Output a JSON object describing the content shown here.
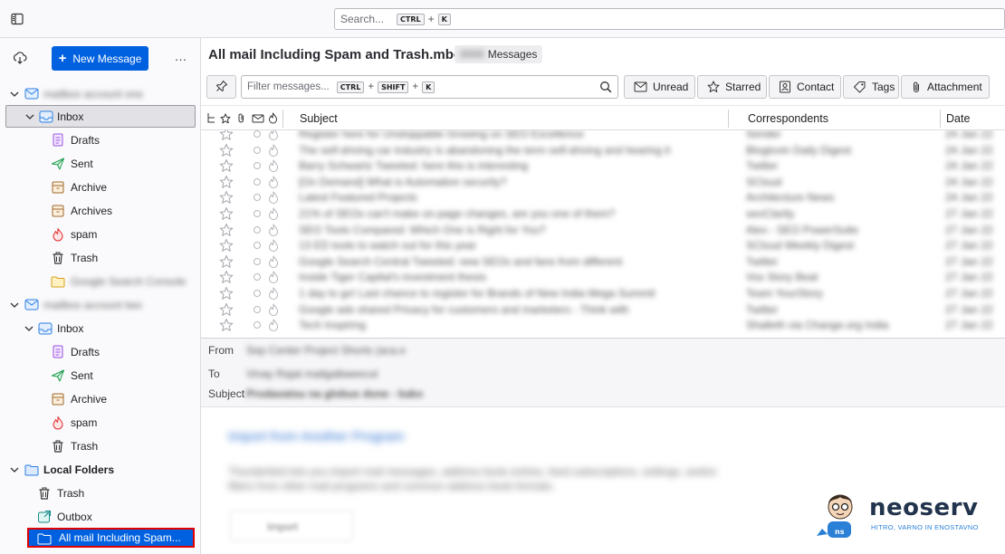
{
  "search": {
    "placeholder": "Search...",
    "kbd1": "CTRL",
    "plus": "+",
    "kbd2": "K"
  },
  "folderpane": {
    "new_message_label": "New Message",
    "menu_label": "…",
    "account1": {
      "name": "mailbox account one",
      "items": [
        "Inbox",
        "Drafts",
        "Sent",
        "Archive",
        "Archives",
        "spam",
        "Trash",
        "Google Search Console"
      ]
    },
    "account2": {
      "name": "mailbox account two",
      "items": [
        "Inbox",
        "Drafts",
        "Sent",
        "Archive",
        "spam",
        "Trash"
      ]
    },
    "local": {
      "name": "Local Folders",
      "items": [
        "Trash",
        "Outbox",
        "All mail Including Spam..."
      ]
    }
  },
  "threadpane": {
    "title": "All mail Including Spam and Trash.mbox",
    "count_number": "0000",
    "count_label": "Messages",
    "filter_placeholder": "Filter messages...",
    "filter_kbd": [
      "CTRL",
      "SHIFT",
      "K"
    ],
    "quick_filters": [
      "Unread",
      "Starred",
      "Contact",
      "Tags",
      "Attachment"
    ],
    "columns": {
      "subject": "Subject",
      "correspondents": "Correspondents",
      "date": "Date"
    },
    "rows": [
      {
        "subject": "Register here for Unstoppable Growing on SEO Excellence",
        "corr": "Sender",
        "date": "24 Jan 22"
      },
      {
        "subject": "The self-driving car industry is abandoning the term self-driving and hearing it",
        "corr": "Bloglovin Daily Digest",
        "date": "24 Jan 22"
      },
      {
        "subject": "Barry Schwartz Tweeted: here this is interesting",
        "corr": "Twitter",
        "date": "24 Jan 22"
      },
      {
        "subject": "[On Demand] What is Automation security?",
        "corr": "SCloud",
        "date": "24 Jan 22"
      },
      {
        "subject": "Latest Featured Projects",
        "corr": "Architecture News",
        "date": "24 Jan 22"
      },
      {
        "subject": "21% of SEOs can't make on-page changes, are you one of them?",
        "corr": "seoClarity",
        "date": "27 Jan 22"
      },
      {
        "subject": "SEO Tools Compared: Which One is Right for You?",
        "corr": "Alex - SEO PowerSuite",
        "date": "27 Jan 22"
      },
      {
        "subject": "13 ED tools to watch out for this year",
        "corr": "SCloud Weekly Digest",
        "date": "27 Jan 22"
      },
      {
        "subject": "Google Search Central Tweeted: new SEOs and fans from different",
        "corr": "Twitter",
        "date": "27 Jan 22"
      },
      {
        "subject": "Inside Tiger Capital's investment thesis",
        "corr": "Vox Story Beat",
        "date": "27 Jan 22"
      },
      {
        "subject": "1 day to go! Last chance to register for Brands of New India Mega Summit",
        "corr": "Team YourStory",
        "date": "27 Jan 22"
      },
      {
        "subject": "Google ads shared Privacy for customers and marketers - Think with",
        "corr": "Twitter",
        "date": "27 Jan 22"
      },
      {
        "subject": "Tech Inspiring",
        "corr": "Shalleth via Change.org India",
        "date": "27 Jan 22"
      }
    ]
  },
  "message": {
    "from_label": "From",
    "to_label": "To",
    "subject_label": "Subject",
    "from_value": "Sep Center Project Shorts (aca.e",
    "to_value": "Vinay Rajat mailgalbaeecut",
    "subject_value": "Prodavatsu na globus done - kako",
    "body_title": "Import from Another Program",
    "body_line1": "Thunderbird lets you import mail messages, address book entries, feed subscriptions, settings, and/or",
    "body_line2": "filters from other mail programs and common address book formats.",
    "body_button": "Import"
  },
  "logo": {
    "brand": "neoserv",
    "tagline": "HITRO, VARNO IN ENOSTAVNO"
  },
  "colors": {
    "accent": "#0061e0",
    "highlight_border": "#e00000"
  }
}
